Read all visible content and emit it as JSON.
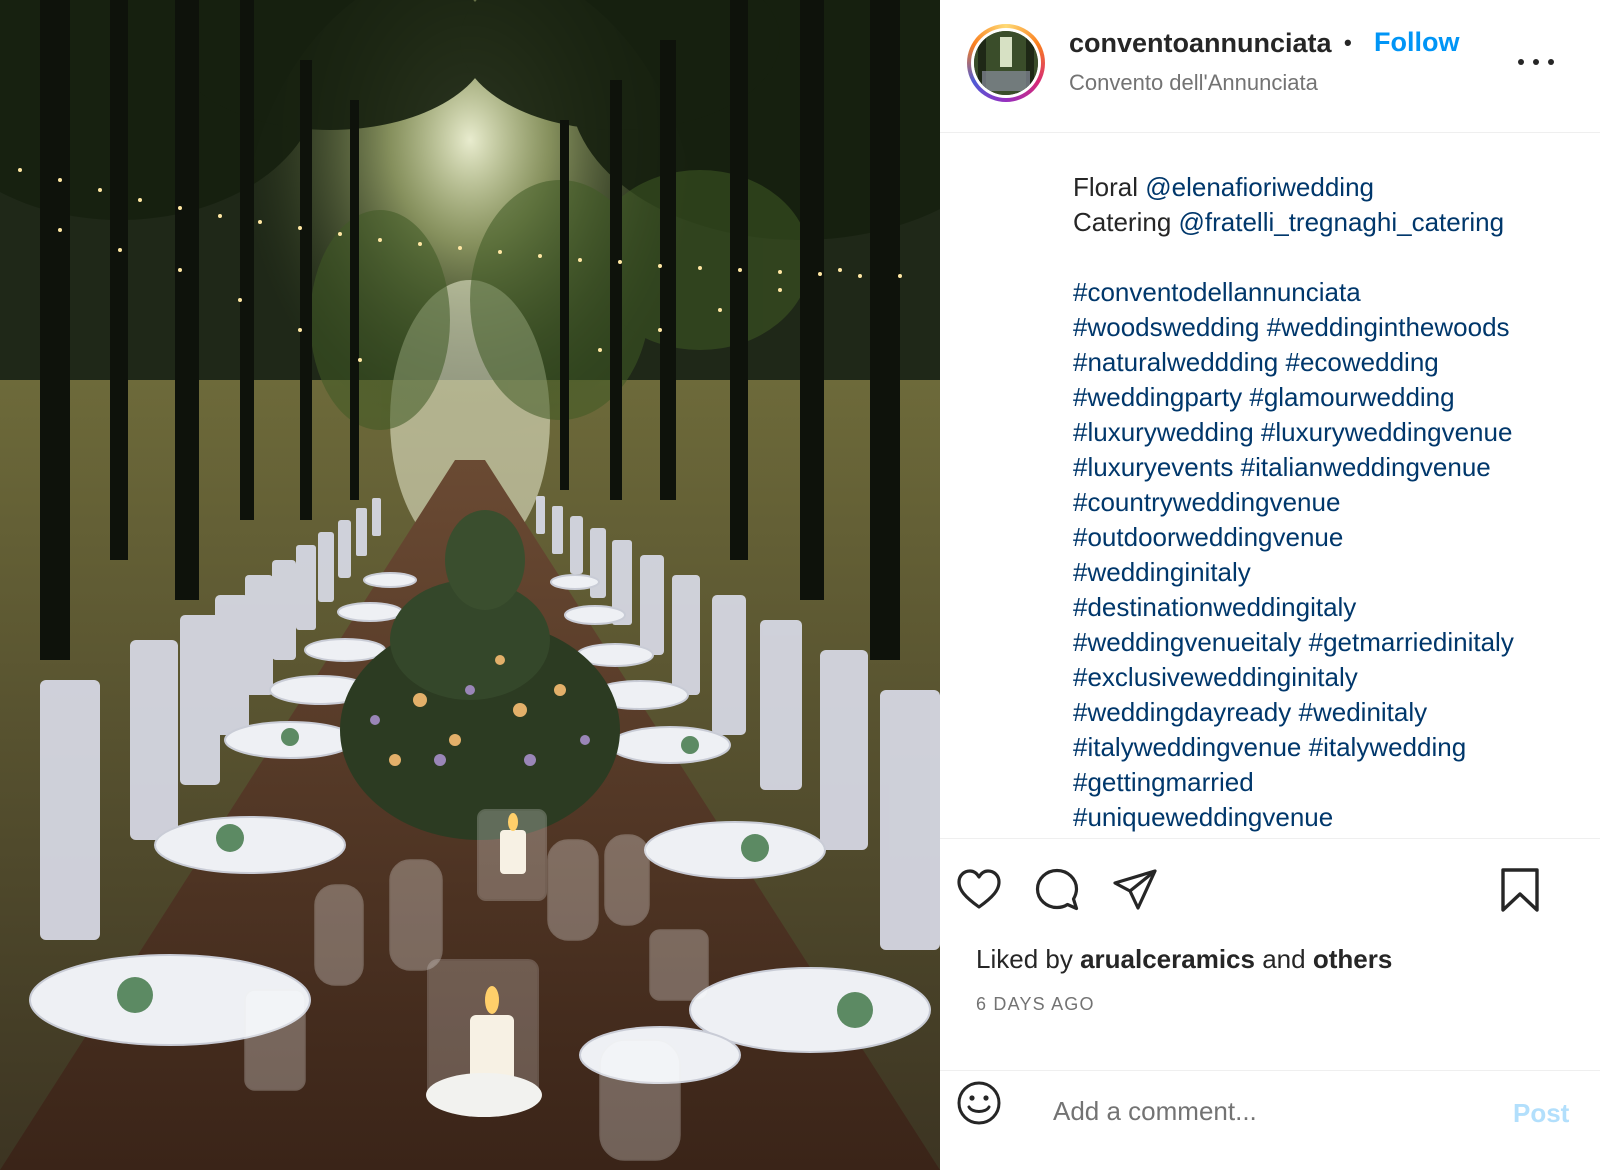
{
  "header": {
    "username": "conventoannunciata",
    "separator": "•",
    "follow_label": "Follow",
    "location": "Convento dell'Annunciata",
    "more_icon": "more-horizontal-icon"
  },
  "caption": {
    "credits": [
      {
        "label": "Floral ",
        "mention": "@elenafioriwedding"
      },
      {
        "label": "Catering ",
        "mention": "@fratelli_tregnaghi_catering"
      }
    ],
    "hashtag_lines": [
      "#conventodellannunciata",
      "#woodswedding #weddinginthewoods",
      "#naturalweddding #ecowedding",
      "#weddingparty #glamourwedding",
      "#luxurywedding #luxuryweddingvenue",
      "#luxuryevents #italianweddingvenue",
      "#countryweddingvenue",
      "#outdoorweddingvenue",
      "#weddinginitaly",
      "#destinationweddingitaly",
      "#weddingvenueitaly #getmarriedinitaly",
      "#exclusiveweddinginitaly",
      "#weddingdayready #wedinitaly",
      "#italyweddingvenue #italywedding",
      "#gettingmarried",
      "#uniqueweddingvenue"
    ]
  },
  "actions": {
    "icons": [
      "heart-icon",
      "comment-icon",
      "share-icon",
      "bookmark-icon"
    ]
  },
  "likes": {
    "prefix": "Liked by ",
    "user": "arualceramics",
    "middle": " and ",
    "others": "others"
  },
  "timestamp": "6 DAYS AGO",
  "comment": {
    "emoji_icon": "emoji-icon",
    "placeholder": "Add a comment...",
    "post_label": "Post"
  },
  "colors": {
    "link_blue": "#0095f6",
    "hashtag_blue": "#00376b",
    "post_disabled": "#b2dffc"
  }
}
